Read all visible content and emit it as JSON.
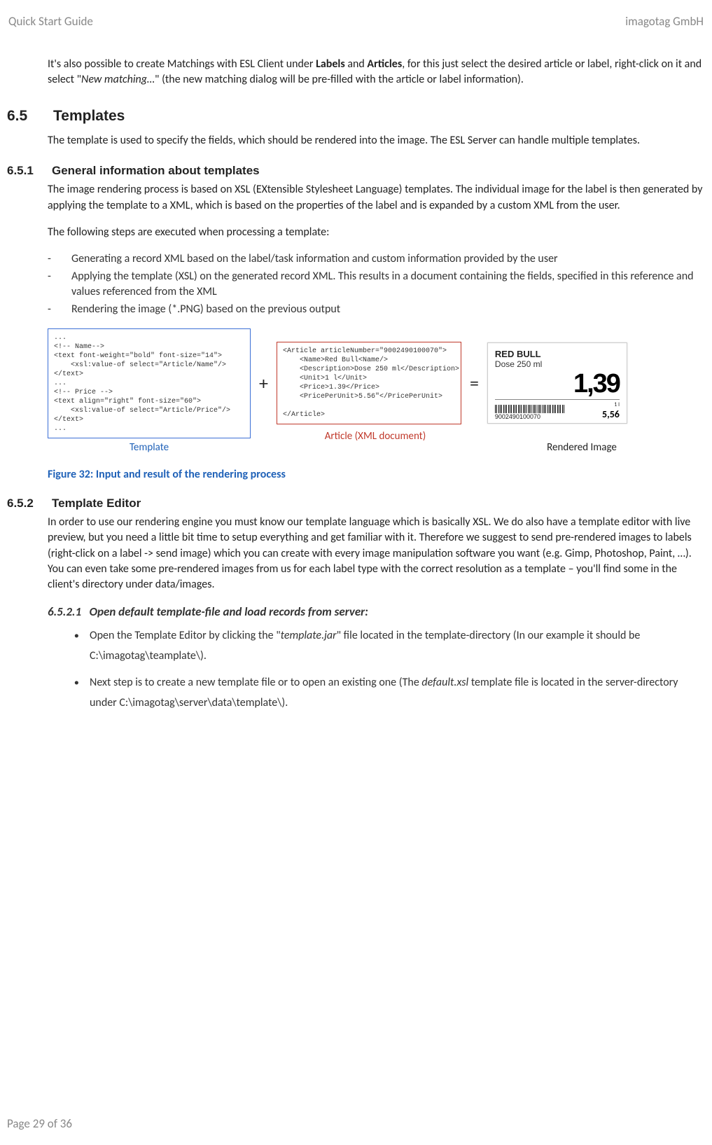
{
  "header": {
    "left": "Quick Start Guide",
    "right": "imagotag GmbH"
  },
  "footer": "Page 29 of 36",
  "intro": {
    "pre": "It's also possible to create Matchings with ESL Client under ",
    "b1": "Labels",
    "mid1": " and ",
    "b2": "Articles",
    "mid2": ", for this just select the desired article or label, right-click on it and select \"",
    "i1": "New matching…",
    "post": "\" (the new matching dialog will be pre-filled with the article or label information)."
  },
  "s65": {
    "num": "6.5",
    "title": "Templates",
    "para": "The template is used to specify the fields, which should be rendered into the image. The ESL Server can handle multiple templates."
  },
  "s651": {
    "num": "6.5.1",
    "title": "General information about templates",
    "p1": "The image rendering process is based on XSL (EXtensible Stylesheet Language) templates. The individual image for the label is then generated by applying the template to a XML, which is based on the properties of the label and is expanded by a custom XML from the user.",
    "p2": "The following steps are executed when processing a template:",
    "steps": [
      "Generating a record XML based on the label/task information and custom information provided by the user",
      "Applying the template (XSL) on the generated record XML. This results in a document containing the fields, specified in this reference and values referenced from the XML",
      "Rendering the image (*.PNG) based on the previous output"
    ]
  },
  "diagram": {
    "templateCode": "...\n<!-- Name-->\n<text font-weight=\"bold\" font-size=\"14\">\n    <xsl:value-of select=\"Article/Name\"/>\n</text>\n...\n<!-- Price -->\n<text align=\"right\" font-size=\"60\">\n    <xsl:value-of select=\"Article/Price\"/>\n</text>\n...",
    "articleCode": "<Article articleNumber=\"9002490100070\">\n    <Name>Red Bull<Name/>\n    <Description>Dose 250 ml</Description>\n    <Unit>1 l</Unit>\n    <Price>1.39</Price>\n    <PricePerUnit>5.56\"</PricePerUnit>\n\n</Article>",
    "plus": "+",
    "equals": "=",
    "labels": {
      "template": "Template",
      "article": "Article (XML document)",
      "rendered": "Rendered Image"
    },
    "rendered": {
      "name": "RED BULL",
      "desc": "Dose 250 ml",
      "price": "1,39",
      "barnum": "9002490100070",
      "unit": "1 l",
      "ppu": "5,56"
    }
  },
  "figCaption": "Figure 32: Input and result of the rendering process",
  "s652": {
    "num": "6.5.2",
    "title": "Template Editor",
    "p1": "In order to use our rendering engine you must know our template language which is basically XSL. We do also have a template editor with live preview, but you need a little bit time to setup everything and get familiar with it. Therefore we suggest to send pre-rendered images to labels (right-click on a label -> send image) which you can create with every image manipulation software you want (e.g. Gimp, Photoshop, Paint, …). You can even take some pre-rendered images from us for each label type with the correct resolution as a template – you'll find some in the client's directory under data/images."
  },
  "s6521": {
    "num": "6.5.2.1",
    "title": "Open default template-file and load records from server:",
    "b1": {
      "pre": "Open the Template Editor by clicking the \"",
      "i": "template.jar",
      "post": "\" file located in the template-directory (In our example it should be C:\\imagotag\\teamplate\\)."
    },
    "b2": {
      "pre": "Next step is to create a new template file or to open an existing one (The ",
      "i": "default.xsl",
      "post": " template file is located in the server-directory under C:\\imagotag\\server\\data\\template\\)."
    }
  }
}
